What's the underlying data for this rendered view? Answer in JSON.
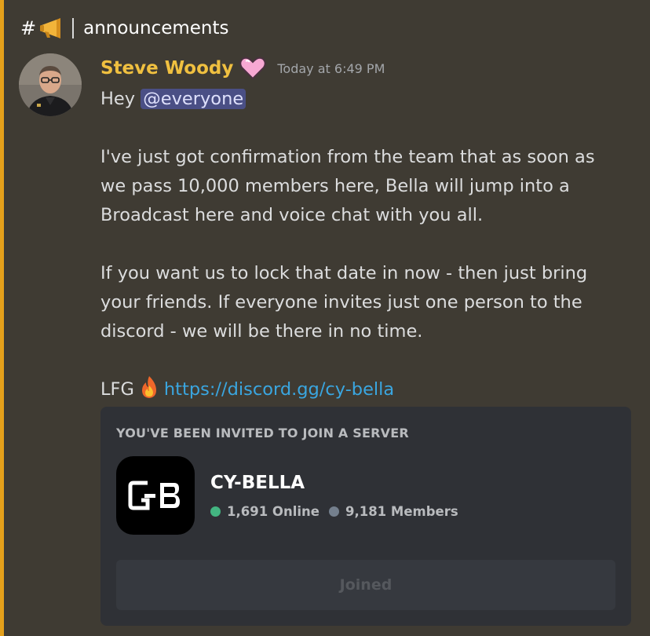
{
  "channel": {
    "hash": "#",
    "name": "announcements",
    "icon": "megaphone-icon"
  },
  "message": {
    "author": "Steve Woody",
    "author_color": "#f0c040",
    "badge_icon": "pink-heart-icon",
    "timestamp": "Today at 6:49 PM",
    "greeting": "Hey",
    "mention": "@everyone",
    "paragraph1": "I've just got confirmation from the team that as soon as we pass 10,000 members here, Bella will jump into a Broadcast here and voice chat with you all.",
    "paragraph2": "If you want us to lock that date in now - then just bring your friends. If everyone invites just one person to the discord - we will be there in no time.",
    "closing": "LFG",
    "closing_icon": "fire-icon",
    "link": "https://discord.gg/cy-bella"
  },
  "invite": {
    "title": "YOU'VE BEEN INVITED TO JOIN A SERVER",
    "server_name": "CY-BELLA",
    "online": "1,691 Online",
    "members": "9,181 Members",
    "button_label": "Joined",
    "online_color": "#43b581",
    "members_color": "#747f8d"
  },
  "accent_color": "#e4a01b"
}
